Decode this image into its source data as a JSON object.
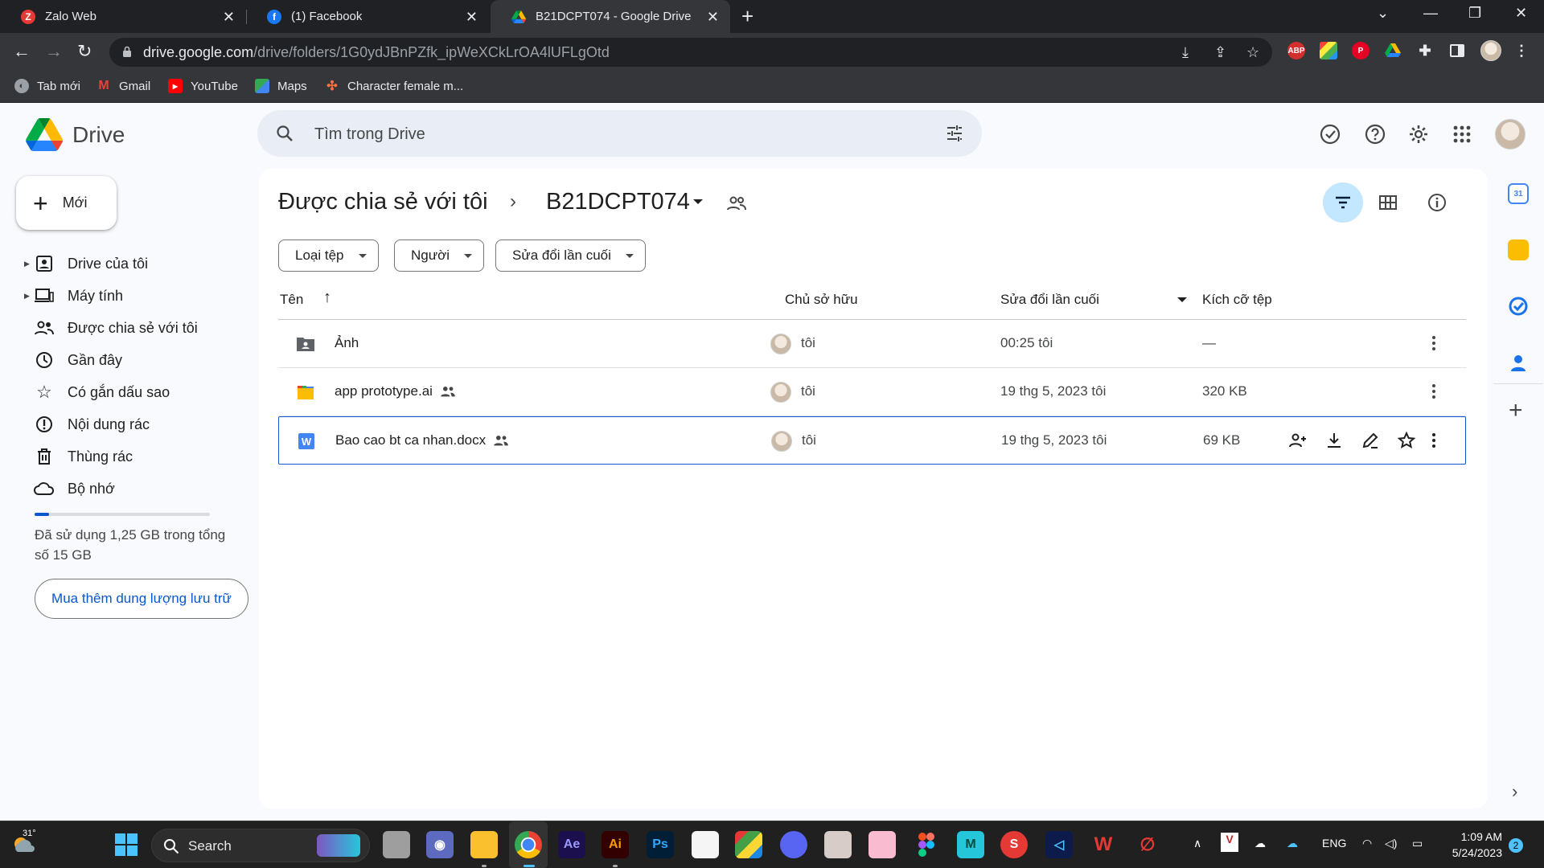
{
  "browser": {
    "tabs": [
      {
        "title": "Zalo Web",
        "favicon": "zalo-icon",
        "color": "#e53935"
      },
      {
        "title": "(1) Facebook",
        "favicon": "facebook-icon",
        "color": "#1877f2"
      },
      {
        "title": "B21DCPT074 - Google Drive",
        "favicon": "drive-icon",
        "color": "#34a853"
      }
    ],
    "url_host": "drive.google.com",
    "url_path": "/drive/folders/1G0ydJBnPZfk_ipWeXCkLrOA4lUFLgOtd",
    "bookmarks": [
      {
        "label": "Tab mới"
      },
      {
        "label": "Gmail"
      },
      {
        "label": "YouTube"
      },
      {
        "label": "Maps"
      },
      {
        "label": "Character female m..."
      }
    ],
    "extensions": {
      "abp": "ABP"
    }
  },
  "drive": {
    "logo_text": "Drive",
    "search_placeholder": "Tìm trong Drive",
    "new_label": "Mới",
    "nav": [
      {
        "label": "Drive của tôi",
        "icon": "my-drive-icon"
      },
      {
        "label": "Máy tính",
        "icon": "computer-icon"
      },
      {
        "label": "Được chia sẻ với tôi",
        "icon": "shared-icon"
      },
      {
        "label": "Gần đây",
        "icon": "clock-icon"
      },
      {
        "label": "Có gắn dấu sao",
        "icon": "star-icon"
      },
      {
        "label": "Nội dung rác",
        "icon": "spam-icon"
      },
      {
        "label": "Thùng rác",
        "icon": "trash-icon"
      },
      {
        "label": "Bộ nhớ",
        "icon": "cloud-icon"
      }
    ],
    "storage": {
      "text": "Đã sử dụng 1,25 GB trong tổng số 15 GB",
      "used_fraction": 0.083,
      "buy_label": "Mua thêm dung lượng lưu trữ"
    },
    "breadcrumb": {
      "parent": "Được chia sẻ với tôi",
      "current": "B21DCPT074"
    },
    "filters": [
      {
        "label": "Loại tệp"
      },
      {
        "label": "Người"
      },
      {
        "label": "Sửa đổi lần cuối"
      }
    ],
    "columns": {
      "name": "Tên",
      "owner": "Chủ sở hữu",
      "modified": "Sửa đổi lần cuối",
      "size": "Kích cỡ tệp"
    },
    "files": [
      {
        "name": "Ảnh",
        "type": "shared-folder",
        "owner": "tôi",
        "modified": "00:25 tôi",
        "size": "—",
        "shared": false
      },
      {
        "name": "app prototype.ai",
        "type": "illustrator",
        "owner": "tôi",
        "modified": "19 thg 5, 2023 tôi",
        "size": "320 KB",
        "shared": true
      },
      {
        "name": "Bao cao bt ca nhan.docx",
        "type": "word",
        "owner": "tôi",
        "modified": "19 thg 5, 2023 tôi",
        "size": "69 KB",
        "shared": true
      }
    ]
  },
  "taskbar": {
    "weather": "31°",
    "search_label": "Search",
    "lang": "ENG",
    "time": "1:09 AM",
    "date": "5/24/2023",
    "notif_count": "2"
  }
}
